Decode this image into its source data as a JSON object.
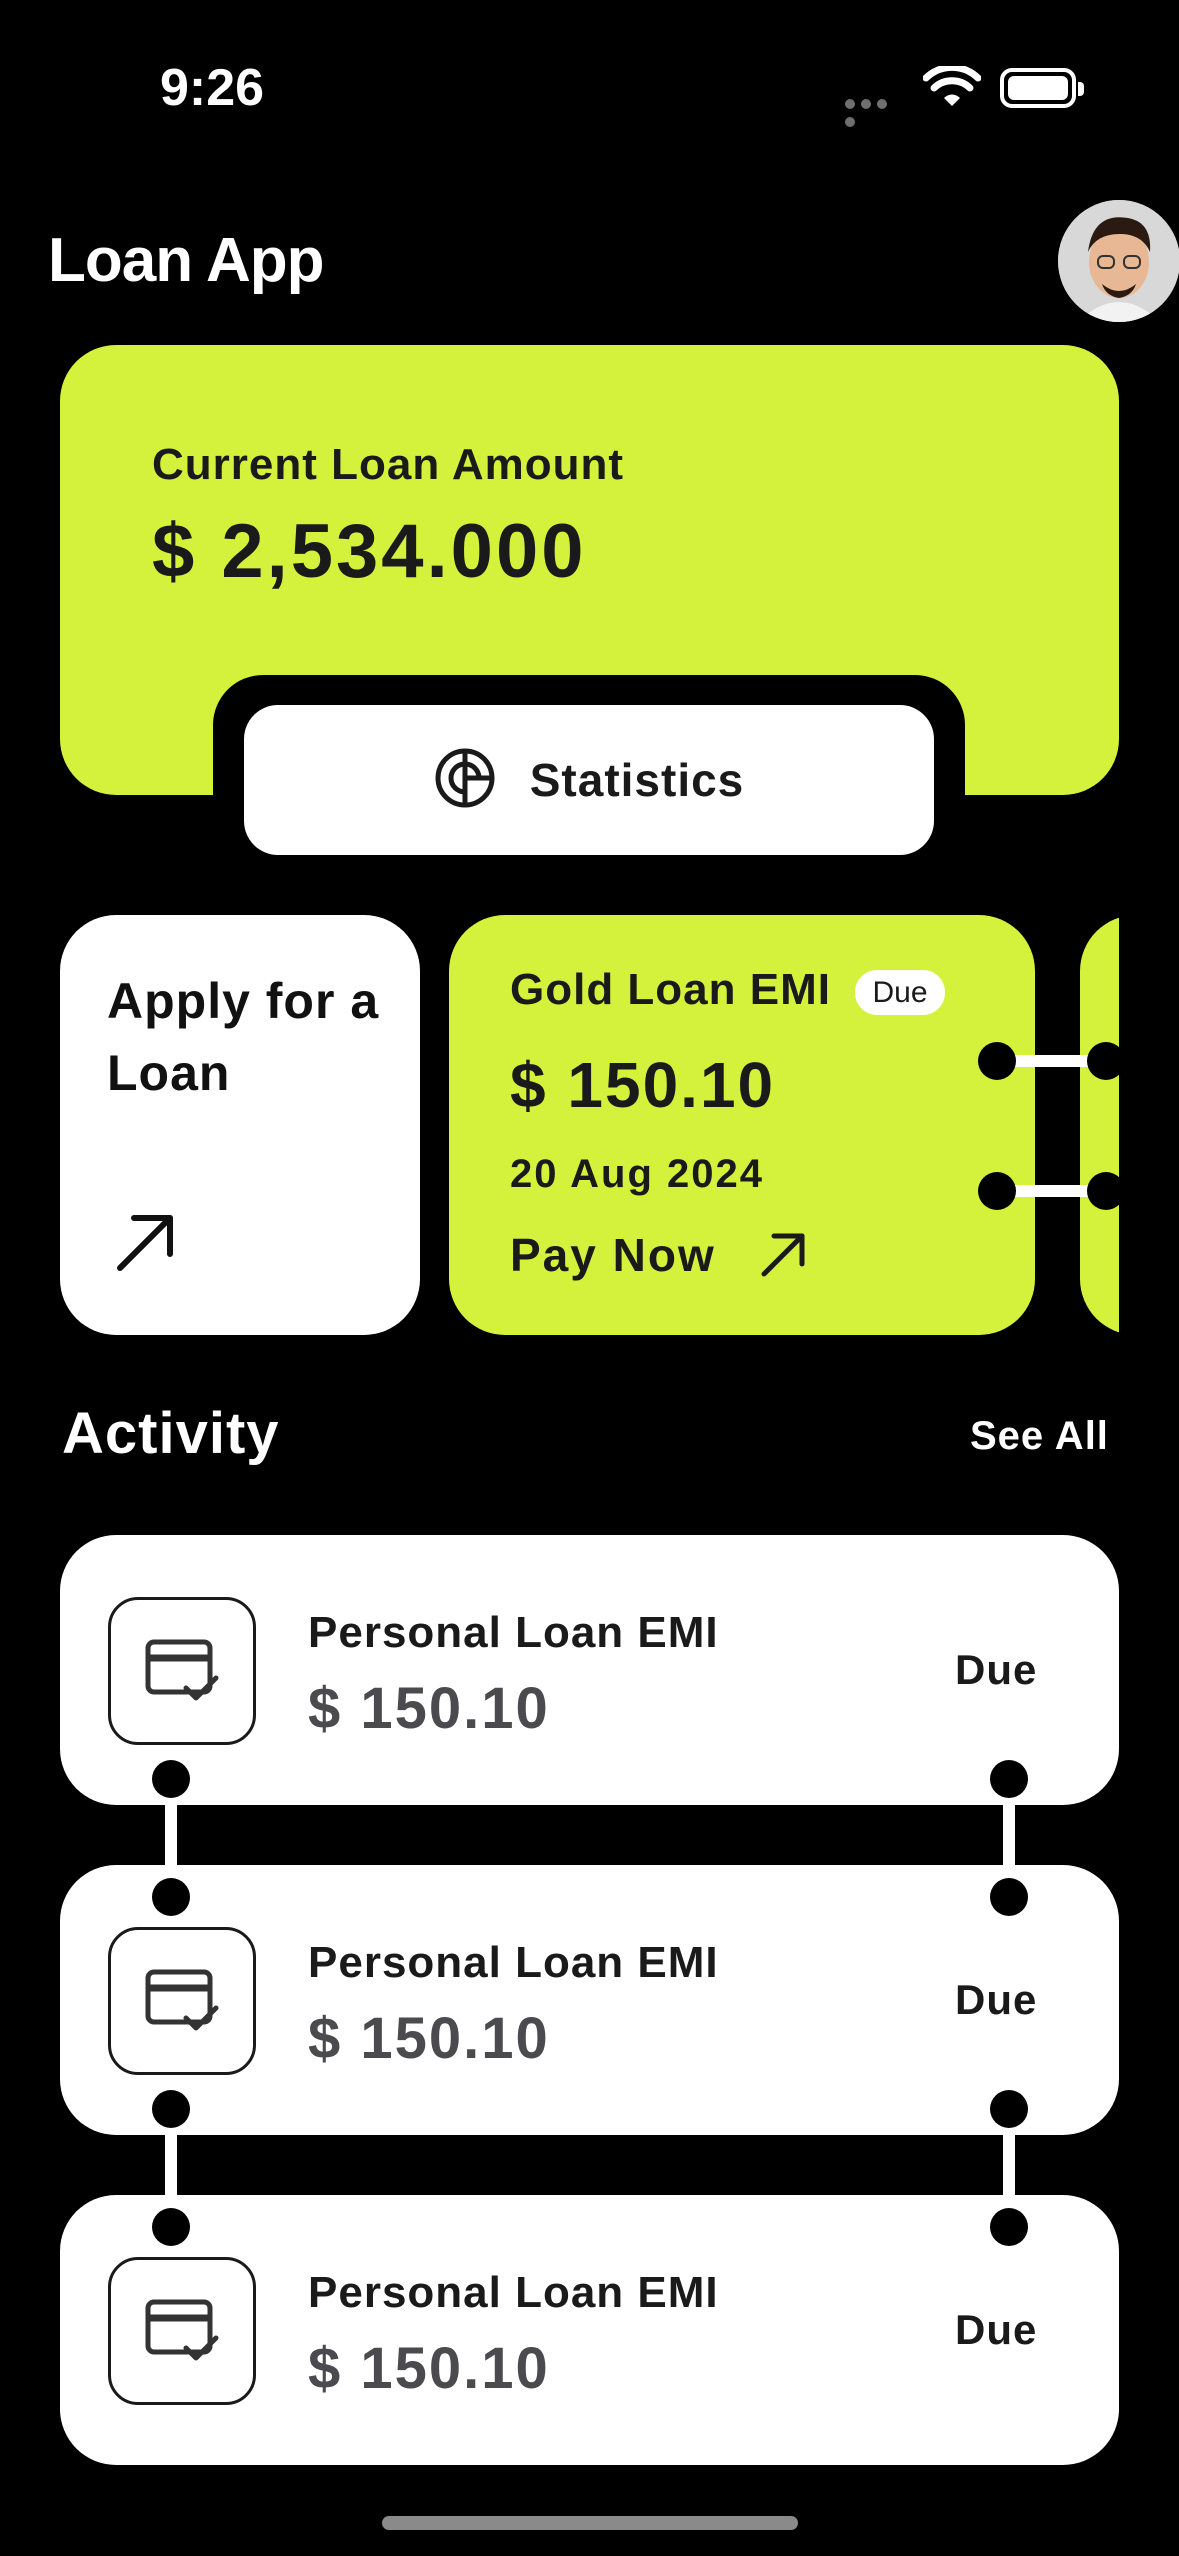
{
  "status_bar": {
    "time": "9:26"
  },
  "header": {
    "title": "Loan App"
  },
  "loan_summary": {
    "label": "Current Loan Amount",
    "amount": "$ 2,534.000",
    "statistics_label": "Statistics"
  },
  "apply_card": {
    "label": "Apply for a Loan"
  },
  "gold_card": {
    "title": "Gold Loan EMI",
    "badge": "Due",
    "amount": "$ 150.10",
    "date": "20 Aug 2024",
    "action": "Pay Now"
  },
  "activity": {
    "title": "Activity",
    "see_all": "See All",
    "items": [
      {
        "title": "Personal Loan EMI",
        "amount": "$ 150.10",
        "status": "Due"
      },
      {
        "title": "Personal Loan EMI",
        "amount": "$ 150.10",
        "status": "Due"
      },
      {
        "title": "Personal Loan EMI",
        "amount": "$ 150.10",
        "status": "Due"
      }
    ]
  },
  "colors": {
    "accent": "#d4f23c",
    "background": "#000000",
    "card": "#ffffff"
  },
  "icons": [
    "wifi-icon",
    "battery-icon",
    "statistics-icon",
    "arrow-up-right-icon",
    "card-check-icon"
  ]
}
